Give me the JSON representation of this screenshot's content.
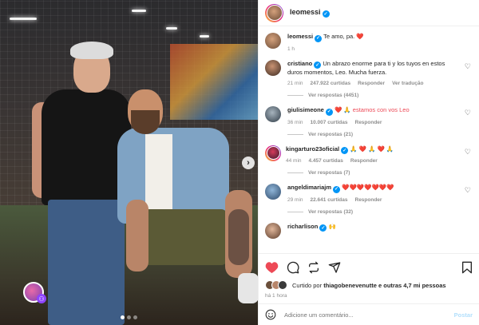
{
  "post": {
    "username": "leomessi",
    "caption": "Te amo, pa.",
    "caption_emoji": "❤️",
    "caption_time": "1 h",
    "carousel_dots": 3,
    "carousel_active": 0
  },
  "comments": [
    {
      "user": "cristiano",
      "verified": true,
      "text": "Un abrazo enorme para ti y los tuyos en estos duros momentos, Leo. Mucha fuerza.",
      "time": "21 min",
      "likes": "247.922 curtidas",
      "reply": "Responder",
      "translate": "Ver tradução",
      "replies_label": "Ver respostas (4451)"
    },
    {
      "user": "giulisimeone",
      "verified": true,
      "text": "❤️ 🙏 estamos con vos Leo",
      "time": "36 min",
      "likes": "10.007 curtidas",
      "reply": "Responder",
      "replies_label": "Ver respostas (21)"
    },
    {
      "user": "kingarturo23oficial",
      "verified": true,
      "text": "🙏 ❤️ 🙏 ❤️ 🙏",
      "time": "44 min",
      "likes": "4.457 curtidas",
      "reply": "Responder",
      "replies_label": "Ver respostas (7)"
    },
    {
      "user": "angeldimariajm",
      "verified": true,
      "text": "❤️❤️❤️❤️❤️❤️❤️",
      "time": "29 min",
      "likes": "22.641 curtidas",
      "reply": "Responder",
      "replies_label": "Ver respostas (32)"
    },
    {
      "user": "richarlison",
      "verified": true,
      "text": "🙌"
    }
  ],
  "actions": {
    "liked_by_prefix": "Curtido por",
    "liked_by_user": "thiagobenevenutte",
    "liked_by_suffix": "e outras 4,7 mi pessoas",
    "time": "há 1 hora"
  },
  "add_comment": {
    "placeholder": "Adicione um comentário...",
    "post_label": "Postar"
  },
  "colors": {
    "like_red": "#ed4956",
    "verified_blue": "#0095f6",
    "post_disabled": "#b2dffc"
  }
}
